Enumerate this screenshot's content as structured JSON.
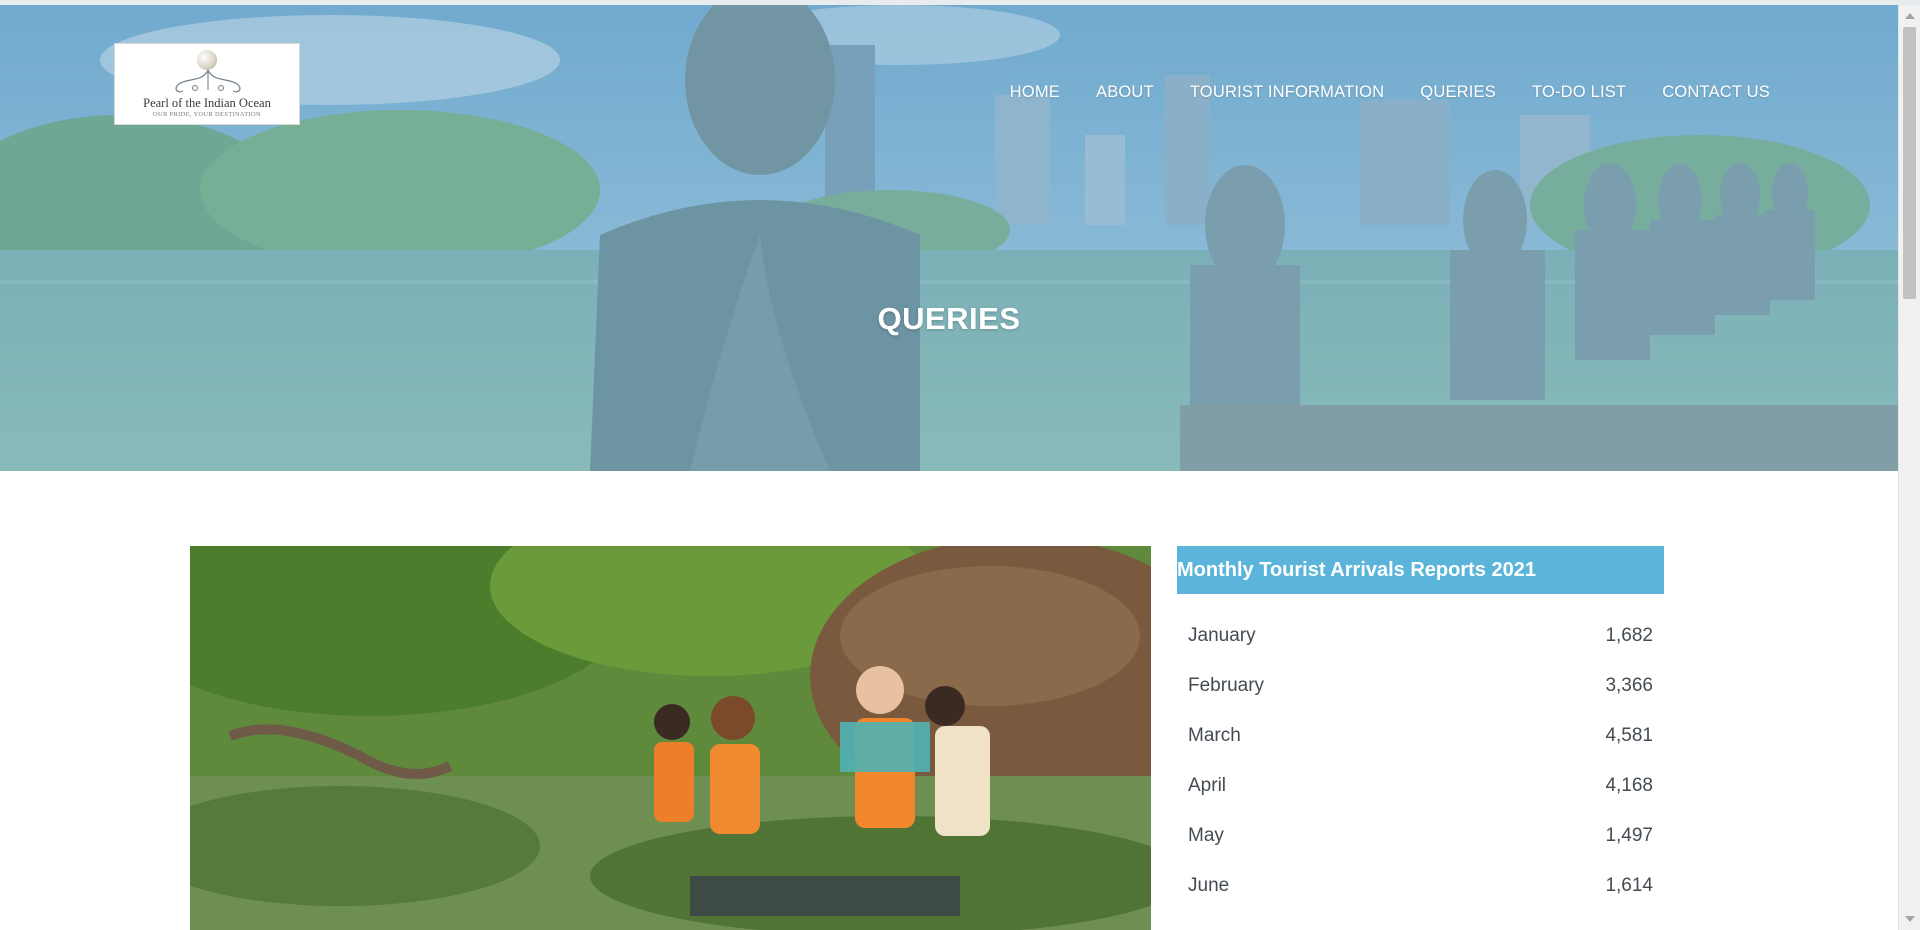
{
  "header": {
    "logo": {
      "name": "Pearl of the Indian Ocean",
      "tagline": "OUR PRIDE, YOUR DESTINATION"
    },
    "nav": [
      {
        "label": "HOME"
      },
      {
        "label": "ABOUT"
      },
      {
        "label": "TOURIST INFORMATION"
      },
      {
        "label": "QUERIES"
      },
      {
        "label": "TO-DO LIST"
      },
      {
        "label": "CONTACT US"
      }
    ]
  },
  "hero": {
    "title": "QUERIES"
  },
  "report": {
    "heading": "Monthly Tourist Arrivals Reports 2021",
    "rows": [
      {
        "month": "January",
        "value": "1,682"
      },
      {
        "month": "February",
        "value": "3,366"
      },
      {
        "month": "March",
        "value": "4,581"
      },
      {
        "month": "April",
        "value": "4,168"
      },
      {
        "month": "May",
        "value": "1,497"
      },
      {
        "month": "June",
        "value": "1,614"
      }
    ]
  },
  "colors": {
    "accent": "#5bb5da",
    "hero_overlay": "#7fb3d3",
    "text": "#444b52"
  }
}
